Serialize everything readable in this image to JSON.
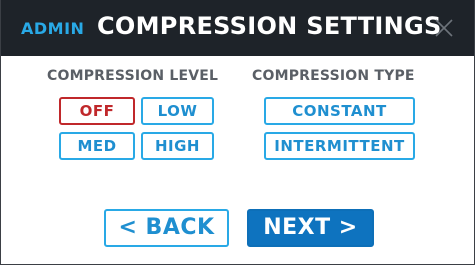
{
  "header": {
    "badge": "ADMIN",
    "title": "COMPRESSION SETTINGS",
    "close_icon": "close-icon"
  },
  "compression_level": {
    "label": "COMPRESSION LEVEL",
    "options": [
      "OFF",
      "LOW",
      "MED",
      "HIGH"
    ],
    "selected": "OFF"
  },
  "compression_type": {
    "label": "COMPRESSION TYPE",
    "options": [
      "CONSTANT",
      "INTERMITTENT"
    ],
    "selected": ""
  },
  "nav": {
    "back_label": "< BACK",
    "next_label": "NEXT >"
  },
  "colors": {
    "accent": "#29a9e6",
    "selected": "#c0282b",
    "header_bg": "#1e2329",
    "primary_button": "#0e73bf"
  }
}
